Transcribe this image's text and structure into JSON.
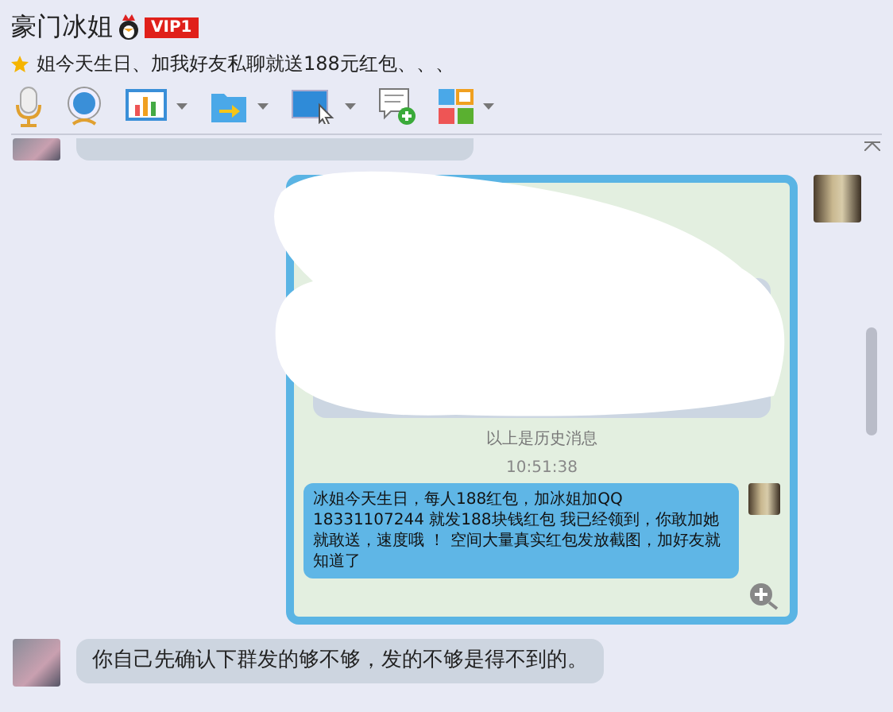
{
  "window": {
    "title": "豪门冰姐",
    "badge": "VIP1"
  },
  "announcement": {
    "text": "姐今天生日、加我好友私聊就送188元红包、、、"
  },
  "toolbar": [
    {
      "kind": "mic",
      "dropdown": false
    },
    {
      "kind": "camera",
      "dropdown": false
    },
    {
      "kind": "chart",
      "dropdown": true
    },
    {
      "kind": "file",
      "dropdown": true
    },
    {
      "kind": "screen",
      "dropdown": true
    },
    {
      "kind": "message",
      "dropdown": false
    },
    {
      "kind": "apps",
      "dropdown": true
    }
  ],
  "messages": [
    {
      "kind": "partial"
    },
    {
      "kind": "image",
      "image": {
        "history_label": "以上是历史消息",
        "time": "10:51:38",
        "message": "冰姐今天生日，每人188红包，加冰姐加QQ 18331107244 就发188块钱红包 我已经领到，你敢加她就敢送，速度哦 ！ 空间大量真实红包发放截图，加好友就知道了"
      }
    },
    {
      "kind": "text",
      "text": "你自己先确认下群发的够不够，发的不够是得不到的。"
    }
  ]
}
